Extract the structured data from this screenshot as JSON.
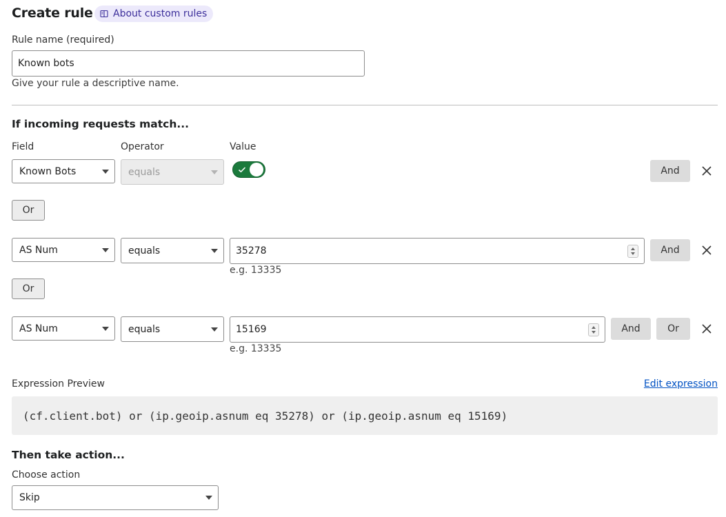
{
  "header": {
    "title": "Create rule",
    "about_link": "About custom rules"
  },
  "rule_name": {
    "label": "Rule name (required)",
    "value": "Known bots",
    "helper": "Give your rule a descriptive name."
  },
  "match": {
    "heading": "If incoming requests match...",
    "col_field": "Field",
    "col_operator": "Operator",
    "col_value": "Value",
    "rows": [
      {
        "field": "Known Bots",
        "operator": "equals",
        "toggle_on": true,
        "and_label": "And"
      },
      {
        "field": "AS Num",
        "operator": "equals",
        "value": "35278",
        "example": "e.g. 13335",
        "and_label": "And"
      },
      {
        "field": "AS Num",
        "operator": "equals",
        "value": "15169",
        "example": "e.g. 13335",
        "and_label": "And",
        "or_label": "Or"
      }
    ],
    "or_separator": "Or"
  },
  "expression": {
    "label": "Expression Preview",
    "edit_link": "Edit expression",
    "text": "(cf.client.bot) or (ip.geoip.asnum eq 35278) or (ip.geoip.asnum eq 15169)"
  },
  "action": {
    "heading": "Then take action...",
    "label": "Choose action",
    "value": "Skip"
  },
  "colors": {
    "toggle_on": "#1b7a3c",
    "link": "#0051c3",
    "pill_bg": "#ece9fb",
    "pill_text": "#3b2e9a"
  }
}
